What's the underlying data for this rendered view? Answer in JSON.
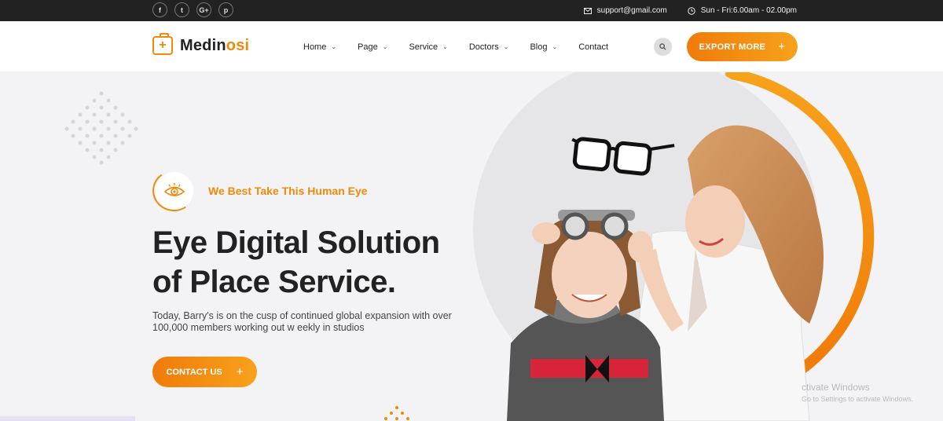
{
  "topbar": {
    "social": [
      {
        "icon": "facebook-icon",
        "glyph": "f"
      },
      {
        "icon": "twitter-icon",
        "glyph": "t"
      },
      {
        "icon": "google-plus-icon",
        "glyph": "G+"
      },
      {
        "icon": "pinterest-icon",
        "glyph": "p"
      }
    ],
    "email": "support@gmail.com",
    "hours": "Sun - Fri:6.00am - 02.00pm"
  },
  "header": {
    "logo_main": "Medin",
    "logo_accent": "osi",
    "nav": [
      {
        "label": "Home",
        "dropdown": true
      },
      {
        "label": "Page",
        "dropdown": true
      },
      {
        "label": "Service",
        "dropdown": true
      },
      {
        "label": "Doctors",
        "dropdown": true
      },
      {
        "label": "Blog",
        "dropdown": true
      },
      {
        "label": "Contact",
        "dropdown": false
      }
    ],
    "search_icon": "search-icon",
    "cta_label": "EXPORT MORE",
    "cta_icon": "+"
  },
  "hero": {
    "tag": "We Best Take This Human Eye",
    "title_line1": "Eye Digital Solution",
    "title_line2": "of Place Service.",
    "description": "Today, Barry's is on the cusp of continued global expansion with over 100,000 members working out w eekly in studios",
    "cta_label": "CONTACT US",
    "cta_icon": "+"
  },
  "watermark": {
    "line1": "ctivate Windows",
    "line2": "Go to Settings to activate Windows."
  },
  "colors": {
    "accent": "#f08a0a",
    "accent_light": "#f7a21b",
    "topbar_bg": "#222222",
    "hero_bg": "#f3f3f5"
  }
}
